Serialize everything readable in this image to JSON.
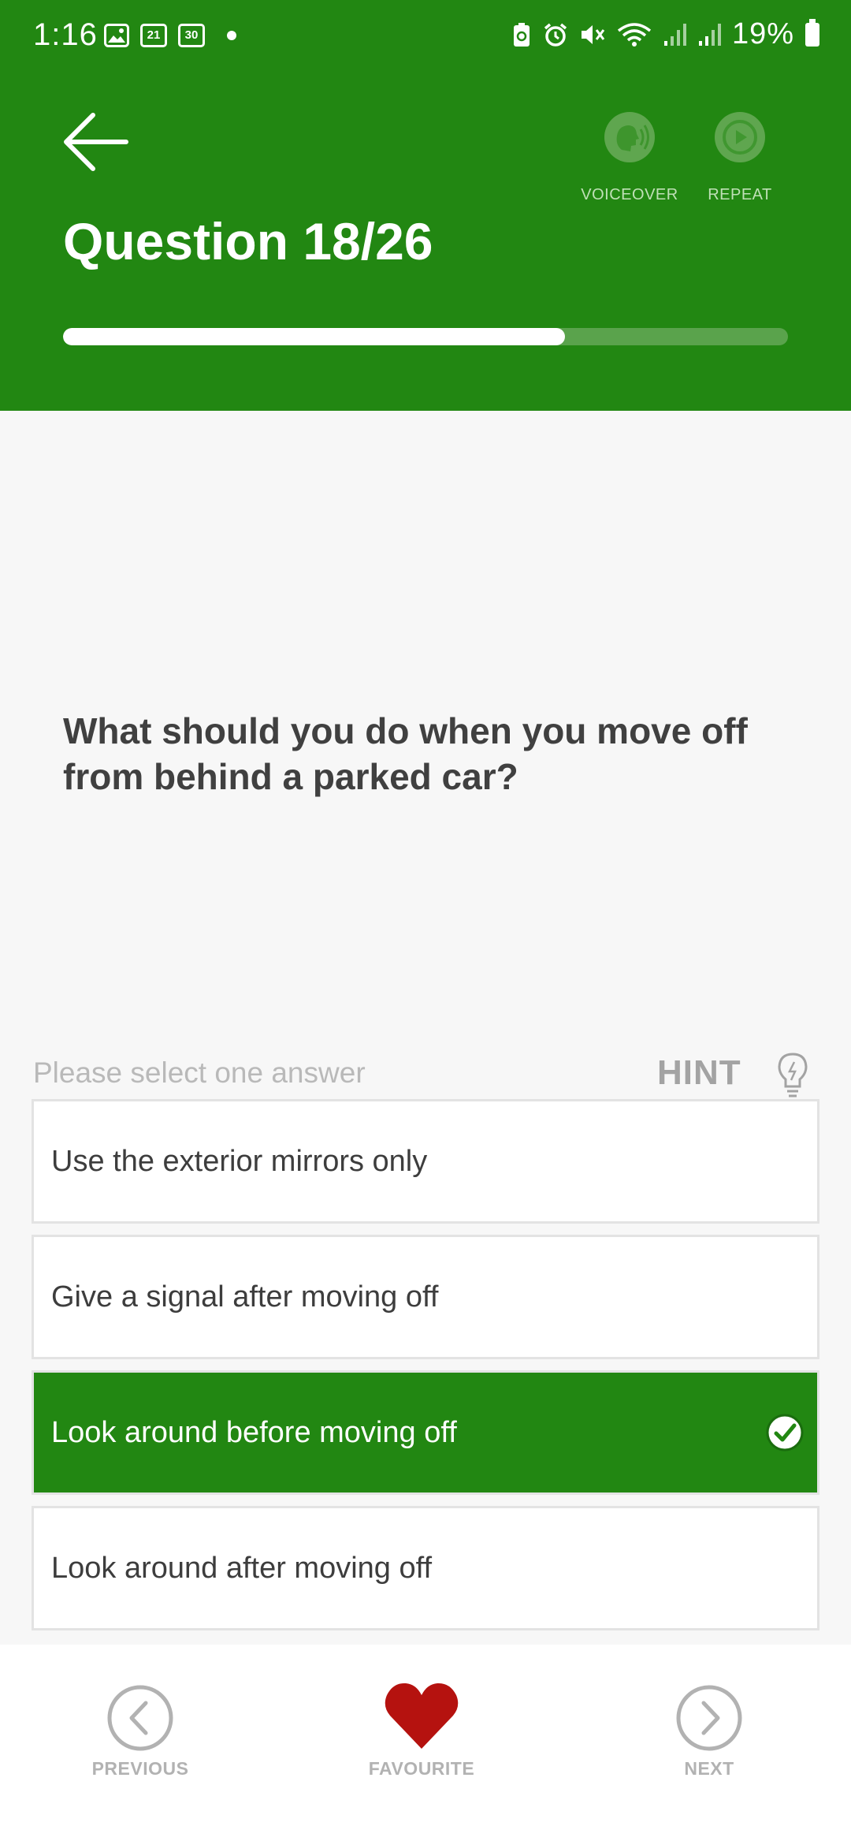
{
  "status_bar": {
    "time": "1:16",
    "calendar_day_1": "21",
    "calendar_day_2": "30",
    "battery": "19%"
  },
  "header": {
    "title": "Question 18/26",
    "voiceover_label": "VOICEOVER",
    "repeat_label": "REPEAT",
    "progress_fraction": 0.6923,
    "background_color": "#228712"
  },
  "question": {
    "text": "What should you do when you move off from behind a parked car?"
  },
  "answers_section": {
    "instruction": "Please select one answer",
    "hint_label": "HINT",
    "options": [
      {
        "text": "Use the exterior mirrors only",
        "selected": false
      },
      {
        "text": "Give a signal after moving off",
        "selected": false
      },
      {
        "text": "Look around before moving off",
        "selected": true
      },
      {
        "text": "Look around after moving off",
        "selected": false
      }
    ]
  },
  "bottom_nav": {
    "previous_label": "PREVIOUS",
    "favourite_label": "FAVOURITE",
    "next_label": "NEXT",
    "favourite_color": "#b5120f"
  }
}
